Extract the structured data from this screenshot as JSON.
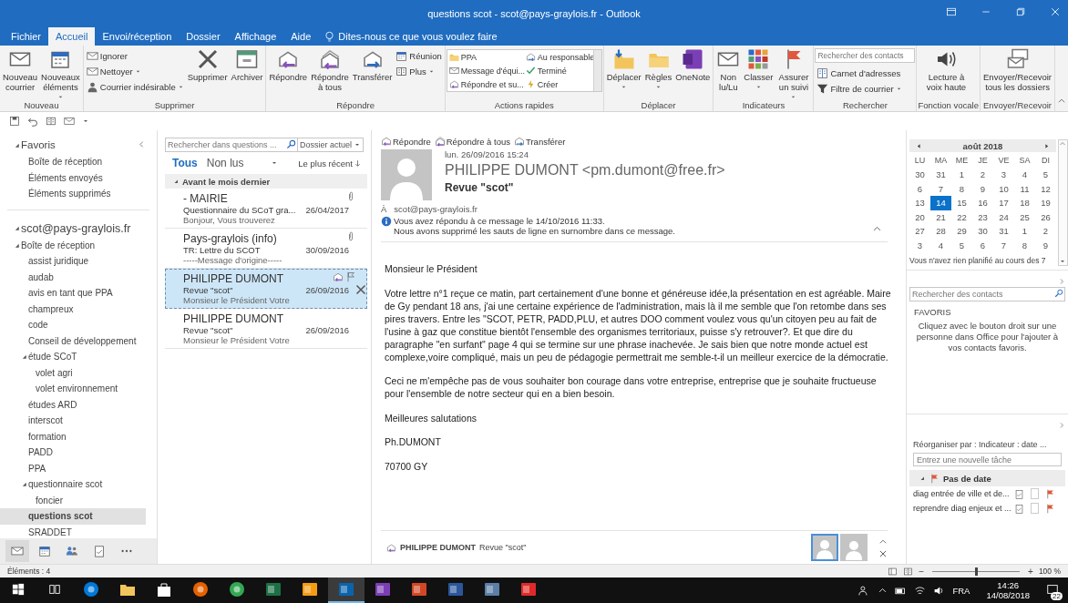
{
  "window": {
    "title": "questions scot - scot@pays-graylois.fr - Outlook"
  },
  "tabs": [
    {
      "label": "Fichier",
      "selected": false
    },
    {
      "label": "Accueil",
      "selected": true
    },
    {
      "label": "Envoi/réception",
      "selected": false
    },
    {
      "label": "Dossier",
      "selected": false
    },
    {
      "label": "Affichage",
      "selected": false
    },
    {
      "label": "Aide",
      "selected": false
    }
  ],
  "tell_me": "Dites-nous ce que vous voulez faire",
  "ribbon": {
    "groups": [
      {
        "label": "Nouveau",
        "items": [
          {
            "kind": "large",
            "label": "Nouveau courrier",
            "dropdown": false
          },
          {
            "kind": "large",
            "label": "Nouveaux éléments",
            "dropdown": true
          }
        ]
      },
      {
        "label": "Supprimer",
        "items": [
          {
            "kind": "small",
            "label": "Ignorer",
            "dropdown": false
          },
          {
            "kind": "small",
            "label": "Nettoyer",
            "dropdown": true
          },
          {
            "kind": "small",
            "label": "Courrier indésirable",
            "dropdown": true
          },
          {
            "kind": "large",
            "label": "Supprimer",
            "dropdown": false
          },
          {
            "kind": "large",
            "label": "Archiver",
            "dropdown": false
          }
        ]
      },
      {
        "label": "Répondre",
        "items": [
          {
            "kind": "large",
            "label": "Répondre",
            "dropdown": false
          },
          {
            "kind": "large",
            "label": "Répondre à tous",
            "dropdown": false
          },
          {
            "kind": "large",
            "label": "Transférer",
            "dropdown": false
          },
          {
            "kind": "small",
            "label": "Réunion",
            "dropdown": false
          },
          {
            "kind": "small",
            "label": "Plus",
            "dropdown": true
          }
        ]
      },
      {
        "label": "Actions rapides",
        "items": [
          {
            "kind": "gallery",
            "label": "PPA"
          },
          {
            "kind": "gallery",
            "label": "Message d'équi..."
          },
          {
            "kind": "gallery",
            "label": "Répondre et su..."
          },
          {
            "kind": "gallery",
            "label": "Au responsable"
          },
          {
            "kind": "gallery",
            "label": "Terminé"
          },
          {
            "kind": "gallery",
            "label": "Créer"
          }
        ]
      },
      {
        "label": "Déplacer",
        "items": [
          {
            "kind": "large",
            "label": "Déplacer",
            "dropdown": true
          },
          {
            "kind": "large",
            "label": "Règles",
            "dropdown": true
          },
          {
            "kind": "large",
            "label": "OneNote",
            "dropdown": false
          }
        ]
      },
      {
        "label": "Indicateurs",
        "items": [
          {
            "kind": "large",
            "label": "Non lu/Lu",
            "dropdown": false
          },
          {
            "kind": "large",
            "label": "Classer",
            "dropdown": true
          },
          {
            "kind": "large",
            "label": "Assurer un suivi",
            "dropdown": true
          }
        ]
      },
      {
        "label": "Rechercher",
        "items": [
          {
            "kind": "search",
            "placeholder": "Rechercher des contacts"
          },
          {
            "kind": "small",
            "label": "Carnet d'adresses",
            "dropdown": false
          },
          {
            "kind": "small",
            "label": "Filtre de courrier",
            "dropdown": true
          }
        ]
      },
      {
        "label": "Fonction vocale",
        "items": [
          {
            "kind": "large",
            "label": "Lecture à voix haute",
            "dropdown": false
          }
        ]
      },
      {
        "label": "Envoyer/Recevoir",
        "items": [
          {
            "kind": "large",
            "label": "Envoyer/Recevoir tous les dossiers",
            "dropdown": false
          }
        ]
      }
    ]
  },
  "sidebar": {
    "favorites_title": "Favoris",
    "favorites": [
      {
        "label": "Boîte de réception",
        "selected": false
      },
      {
        "label": "Éléments envoyés",
        "selected": false
      },
      {
        "label": "Éléments supprimés",
        "selected": false
      }
    ],
    "account": "scot@pays-graylois.fr",
    "folders": [
      {
        "label": "Boîte de réception",
        "selected": false,
        "children": [
          {
            "label": "assist juridique",
            "selected": false
          },
          {
            "label": "audab",
            "selected": false
          },
          {
            "label": "avis en tant que PPA",
            "selected": false
          },
          {
            "label": "champreux",
            "selected": false
          },
          {
            "label": "code",
            "selected": false
          },
          {
            "label": "Conseil de développement",
            "selected": false
          },
          {
            "label": "étude SCoT",
            "selected": false,
            "children": [
              {
                "label": "volet agri",
                "selected": false
              },
              {
                "label": "volet environnement",
                "selected": false
              }
            ]
          },
          {
            "label": "études ARD",
            "selected": false
          },
          {
            "label": "interscot",
            "selected": false
          },
          {
            "label": "formation",
            "selected": false
          },
          {
            "label": "PADD",
            "selected": false
          },
          {
            "label": "PPA",
            "selected": false
          },
          {
            "label": "questionnaire scot",
            "selected": false,
            "children": [
              {
                "label": "foncier",
                "selected": false
              }
            ]
          },
          {
            "label": "questions scot",
            "selected": true
          },
          {
            "label": "SRADDET",
            "selected": false
          }
        ]
      }
    ],
    "nav": [
      {
        "selected": true
      },
      {
        "selected": false
      },
      {
        "selected": false
      },
      {
        "selected": false
      },
      {
        "selected": false
      }
    ]
  },
  "message_list": {
    "search_placeholder": "Rechercher dans questions ...",
    "scope": "Dossier actuel",
    "filters": [
      {
        "label": "Tous",
        "selected": true
      },
      {
        "label": "Non lus",
        "selected": false
      }
    ],
    "sort": "Le plus récent",
    "group": "Avant le mois dernier",
    "messages": [
      {
        "sender": "- MAIRIE",
        "subject": "Questionnaire du SCoT gra...",
        "preview": "Bonjour,  Vous trouverez",
        "date": "26/04/2017",
        "attachment": true,
        "replied": false,
        "selected": false
      },
      {
        "sender": "Pays-graylois (info)",
        "subject": "TR: Lettre du SCOT",
        "preview": "-----Message d'origine-----",
        "date": "30/09/2016",
        "attachment": true,
        "replied": false,
        "selected": false
      },
      {
        "sender": "PHILIPPE DUMONT",
        "subject": "Revue \"scot\"",
        "preview": "Monsieur le Président  Votre",
        "date": "26/09/2016",
        "attachment": false,
        "replied": true,
        "selected": true
      },
      {
        "sender": "PHILIPPE DUMONT",
        "subject": "Revue \"scot\"",
        "preview": "Monsieur le Président  Votre",
        "date": "26/09/2016",
        "attachment": false,
        "replied": false,
        "selected": false
      }
    ]
  },
  "reading_pane": {
    "actions": [
      "Répondre",
      "Répondre à tous",
      "Transférer"
    ],
    "date": "lun. 26/09/2016 15:24",
    "from": "PHILIPPE DUMONT <pm.dumont@free.fr>",
    "subject": "Revue \"scot\"",
    "to_label": "À",
    "to": "scot@pays-graylois.fr",
    "info": [
      "Vous avez répondu à ce message le 14/10/2016 11:33.",
      "Nous avons supprimé les sauts de ligne en surnombre dans ce message."
    ],
    "body": [
      "Monsieur le Président",
      "Votre lettre n°1 reçue ce matin, part certainement d'une bonne et généreuse idée,la présentation en est agréable. Maire de Gy pendant 18 ans, j'ai une certaine expérience de l'administration, mais là il me semble que l'on retombe dans ses pires travers. Entre les \"SCOT, PETR, PADD,PLU, et autres DOO comment voulez vous qu'un citoyen peu au fait de l'usine à gaz que constitue bientôt l'ensemble des organismes territoriaux, puisse s'y retrouver?. Et que dire du paragraphe \"en surfant\" page 4 qui se termine sur une phrase inachevée. Je sais bien que notre monde actuel est complexe,voire compliqué, mais un peu de pédagogie permettrait me semble-t-il un meilleur exercice de la démocratie.",
      "Ceci ne m'empêche pas de vous souhaiter bon courage dans votre entreprise, entreprise que je souhaite fructueuse pour l'ensemble de notre secteur qui en a bien besoin.",
      "Meilleures salutations",
      "Ph.DUMONT",
      "70700  GY"
    ],
    "footer_sender": "PHILIPPE DUMONT",
    "footer_subject": "Revue \"scot\"",
    "people": [
      {
        "selected": true
      },
      {
        "selected": false
      }
    ]
  },
  "calendar": {
    "month": "août 2018",
    "weekdays": [
      "LU",
      "MA",
      "ME",
      "JE",
      "VE",
      "SA",
      "DI"
    ],
    "weeks": [
      [
        {
          "label": "30",
          "selected": false
        },
        {
          "label": "31",
          "selected": false
        },
        {
          "label": "1",
          "selected": false
        },
        {
          "label": "2",
          "selected": false
        },
        {
          "label": "3",
          "selected": false
        },
        {
          "label": "4",
          "selected": false
        },
        {
          "label": "5",
          "selected": false
        }
      ],
      [
        {
          "label": "6",
          "selected": false
        },
        {
          "label": "7",
          "selected": false
        },
        {
          "label": "8",
          "selected": false
        },
        {
          "label": "9",
          "selected": false
        },
        {
          "label": "10",
          "selected": false
        },
        {
          "label": "11",
          "selected": false
        },
        {
          "label": "12",
          "selected": false
        }
      ],
      [
        {
          "label": "13",
          "selected": false
        },
        {
          "label": "14",
          "selected": true
        },
        {
          "label": "15",
          "selected": false
        },
        {
          "label": "16",
          "selected": false
        },
        {
          "label": "17",
          "selected": false
        },
        {
          "label": "18",
          "selected": false
        },
        {
          "label": "19",
          "selected": false
        }
      ],
      [
        {
          "label": "20",
          "selected": false
        },
        {
          "label": "21",
          "selected": false
        },
        {
          "label": "22",
          "selected": false
        },
        {
          "label": "23",
          "selected": false
        },
        {
          "label": "24",
          "selected": false
        },
        {
          "label": "25",
          "selected": false
        },
        {
          "label": "26",
          "selected": false
        }
      ],
      [
        {
          "label": "27",
          "selected": false
        },
        {
          "label": "28",
          "selected": false
        },
        {
          "label": "29",
          "selected": false
        },
        {
          "label": "30",
          "selected": false
        },
        {
          "label": "31",
          "selected": false
        },
        {
          "label": "1",
          "selected": false
        },
        {
          "label": "2",
          "selected": false
        }
      ],
      [
        {
          "label": "3",
          "selected": false
        },
        {
          "label": "4",
          "selected": false
        },
        {
          "label": "5",
          "selected": false
        },
        {
          "label": "6",
          "selected": false
        },
        {
          "label": "7",
          "selected": false
        },
        {
          "label": "8",
          "selected": false
        },
        {
          "label": "9",
          "selected": false
        }
      ]
    ],
    "note": "Vous n'avez rien planifié au cours des 7"
  },
  "people_pane": {
    "search_placeholder": "Rechercher des contacts",
    "title": "FAVORIS",
    "message": "Cliquez avec le bouton droit sur une personne dans Office pour l'ajouter à vos contacts favoris."
  },
  "tasks": {
    "arrange": "Réorganiser par : Indicateur : date ...",
    "new_placeholder": "Entrez une nouvelle tâche",
    "group": "Pas de date",
    "items": [
      {
        "label": "diag entrée de ville et de...",
        "checked": false
      },
      {
        "label": "reprendre diag enjeux et ...",
        "checked": false
      }
    ]
  },
  "status_bar": {
    "items": "Éléments : 4",
    "zoom_out": "−",
    "zoom_in": "+",
    "zoom": {
      "level": 0.5,
      "reading": "100 %"
    }
  },
  "taskbar": {
    "apps": [
      {
        "selected": false
      },
      {
        "selected": false
      },
      {
        "selected": false
      },
      {
        "selected": false
      },
      {
        "selected": false
      },
      {
        "selected": false
      },
      {
        "selected": false
      },
      {
        "selected": true
      },
      {
        "selected": false
      },
      {
        "selected": false
      },
      {
        "selected": false
      },
      {
        "selected": false
      },
      {
        "selected": false
      }
    ],
    "language": "FRA",
    "time": "14:26",
    "date": "14/08/2018",
    "notifications": "22"
  }
}
